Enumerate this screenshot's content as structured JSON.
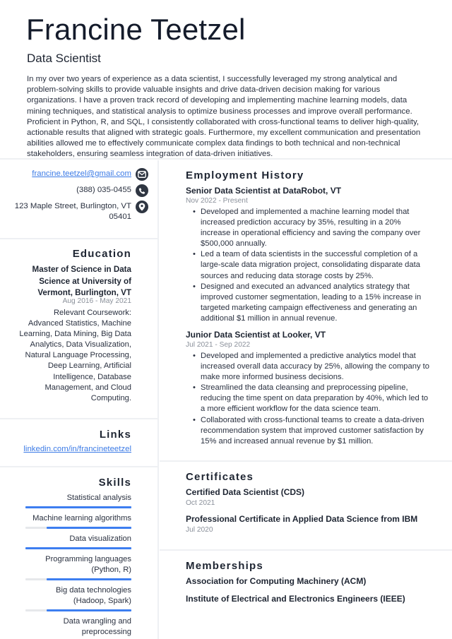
{
  "header": {
    "name": "Francine Teetzel",
    "title": "Data Scientist",
    "summary": "In my over two years of experience as a data scientist, I successfully leveraged my strong analytical and problem-solving skills to provide valuable insights and drive data-driven decision making for various organizations. I have a proven track record of developing and implementing machine learning models, data mining techniques, and statistical analysis to optimize business processes and improve overall performance. Proficient in Python, R, and SQL, I consistently collaborated with cross-functional teams to deliver high-quality, actionable results that aligned with strategic goals. Furthermore, my excellent communication and presentation abilities allowed me to effectively communicate complex data findings to both technical and non-technical stakeholders, ensuring seamless integration of data-driven initiatives."
  },
  "contact": {
    "email": "francine.teetzel@gmail.com",
    "phone": "(388) 035-0455",
    "address_line1": "123 Maple Street, Burlington, VT",
    "address_line2": "05401",
    "icons": [
      "envelope-icon",
      "phone-icon",
      "map-pin-icon"
    ],
    "icon_bg": "#2f3642"
  },
  "education": {
    "heading": "Education",
    "degree": "Master of Science in Data Science at University of Vermont, Burlington, VT",
    "dates": "Aug 2016 - May 2021",
    "description": "Relevant Coursework: Advanced Statistics, Machine Learning, Data Mining, Big Data Analytics, Data Visualization, Natural Language Processing, Deep Learning, Artificial Intelligence, Database Management, and Cloud Computing."
  },
  "links": {
    "heading": "Links",
    "items": [
      {
        "label": "linkedin.com/in/francineteetzel"
      }
    ]
  },
  "skills": {
    "heading": "Skills",
    "accent": "#3d7ef0",
    "track": "#e6e8eb",
    "items": [
      {
        "name": "Statistical analysis",
        "level": 1.0
      },
      {
        "name": "Machine learning algorithms",
        "level": 0.8
      },
      {
        "name": "Data visualization",
        "level": 1.0
      },
      {
        "name": "Programming languages (Python, R)",
        "level": 0.8
      },
      {
        "name": "Big data technologies (Hadoop, Spark)",
        "level": 0.8
      },
      {
        "name": "Data wrangling and preprocessing",
        "level": null
      }
    ]
  },
  "employment": {
    "heading": "Employment History",
    "jobs": [
      {
        "title": "Senior Data Scientist at DataRobot, VT",
        "dates": "Nov 2022 - Present",
        "bullets": [
          "Developed and implemented a machine learning model that increased prediction accuracy by 35%, resulting in a 20% increase in operational efficiency and saving the company over $500,000 annually.",
          "Led a team of data scientists in the successful completion of a large-scale data migration project, consolidating disparate data sources and reducing data storage costs by 25%.",
          "Designed and executed an advanced analytics strategy that improved customer segmentation, leading to a 15% increase in targeted marketing campaign effectiveness and generating an additional $1 million in annual revenue."
        ]
      },
      {
        "title": "Junior Data Scientist at Looker, VT",
        "dates": "Jul 2021 - Sep 2022",
        "bullets": [
          "Developed and implemented a predictive analytics model that increased overall data accuracy by 25%, allowing the company to make more informed business decisions.",
          "Streamlined the data cleansing and preprocessing pipeline, reducing the time spent on data preparation by 40%, which led to a more efficient workflow for the data science team.",
          "Collaborated with cross-functional teams to create a data-driven recommendation system that improved customer satisfaction by 15% and increased annual revenue by $1 million."
        ]
      }
    ]
  },
  "certificates": {
    "heading": "Certificates",
    "items": [
      {
        "title": "Certified Data Scientist (CDS)",
        "date": "Oct 2021"
      },
      {
        "title": "Professional Certificate in Applied Data Science from IBM",
        "date": "Jul 2020"
      }
    ]
  },
  "memberships": {
    "heading": "Memberships",
    "items": [
      {
        "title": "Association for Computing Machinery (ACM)"
      },
      {
        "title": "Institute of Electrical and Electronics Engineers (IEEE)"
      }
    ]
  }
}
